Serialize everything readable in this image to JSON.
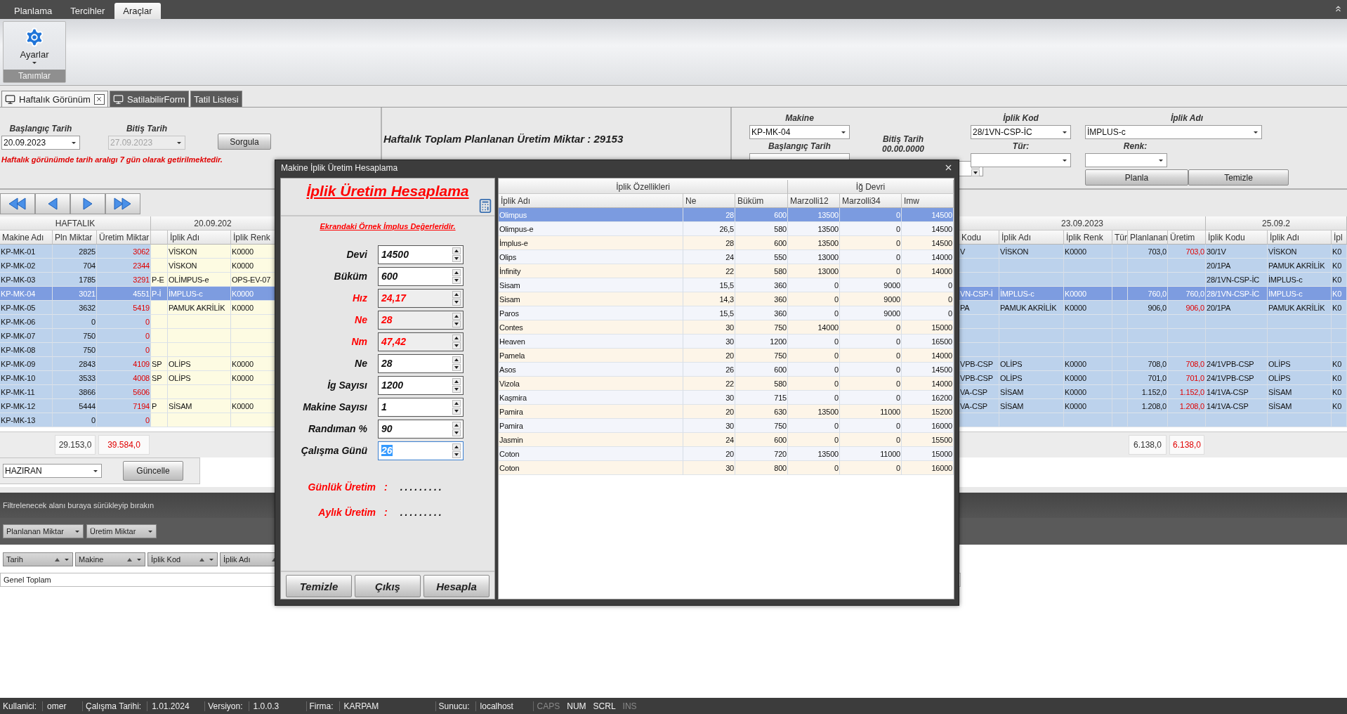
{
  "menu_tabs": [
    {
      "label": "Planlama",
      "selected": false
    },
    {
      "label": "Tercihler",
      "selected": false
    },
    {
      "label": "Araçlar",
      "selected": true
    }
  ],
  "ribbon": {
    "button": "Ayarlar",
    "group": "Tanımlar"
  },
  "doc_tabs": [
    {
      "label": "Haftalık Görünüm",
      "selected": true,
      "closable": true,
      "has_icon": true
    },
    {
      "label": "SatilabilirForm",
      "selected": false,
      "closable": false,
      "has_icon": true
    },
    {
      "label": "Tatil Listesi",
      "selected": false,
      "closable": false,
      "has_icon": false
    }
  ],
  "query": {
    "start_label": "Başlangıç Tarih",
    "start_value": "20.09.2023",
    "end_label": "Bitiş Tarih",
    "end_value": "27.09.2023",
    "end_disabled": true,
    "button": "Sorgula",
    "note": "Haftalık görünümde tarih aralıgı 7 gün olarak getirilmektedir."
  },
  "total_text": "Haftalık Toplam Planlanan Üretim Miktar : 29153",
  "plan_form": {
    "machine_label": "Makine",
    "machine_value": "KP-MK-04",
    "start_label": "Başlangıç Tarih",
    "end_label": "Bitiş Tarih",
    "end_value": "00.00.0000",
    "code_label": "İplik Kod",
    "code_value": "28/1VN-CSP-İC",
    "type_label": "Tür:",
    "name_label": "İplik Adı",
    "name_value": "İMPLUS-c",
    "shade_label": "Renk:",
    "buttons": [
      "Planla",
      "Temizle"
    ]
  },
  "left_grid": {
    "groups": [
      "HAFTALIK",
      "20.09.202"
    ],
    "columns": [
      "Makine Adı",
      "Pln Miktar",
      "Üretim Miktar",
      null,
      "İplik Adı",
      "İplik Renk"
    ],
    "rows": [
      {
        "cells": [
          "KP-MK-01",
          "2825",
          "3062",
          null,
          "VİSKON",
          "K0000"
        ],
        "selected": false
      },
      {
        "cells": [
          "KP-MK-02",
          "704",
          "2344",
          null,
          "VİSKON",
          "K0000"
        ],
        "selected": false
      },
      {
        "cells": [
          "KP-MK-03",
          "1785",
          "3291",
          "P-E",
          "OLİMPUS-e",
          "OPS-EV-07"
        ],
        "selected": false
      },
      {
        "cells": [
          "KP-MK-04",
          "3021",
          "4551",
          "P-İ",
          "İMPLUS-c",
          "K0000"
        ],
        "selected": true
      },
      {
        "cells": [
          "KP-MK-05",
          "3632",
          "5419",
          null,
          "PAMUK AKRİLİK",
          "K0000"
        ],
        "selected": false
      },
      {
        "cells": [
          "KP-MK-06",
          "0",
          "0",
          null,
          null,
          null
        ],
        "selected": false
      },
      {
        "cells": [
          "KP-MK-07",
          "750",
          "0",
          null,
          null,
          null
        ],
        "selected": false
      },
      {
        "cells": [
          "KP-MK-08",
          "750",
          "0",
          null,
          null,
          null
        ],
        "selected": false
      },
      {
        "cells": [
          "KP-MK-09",
          "2843",
          "4109",
          "SP",
          "OLİPS",
          "K0000"
        ],
        "selected": false
      },
      {
        "cells": [
          "KP-MK-10",
          "3533",
          "4008",
          "SP",
          "OLİPS",
          "K0000"
        ],
        "selected": false
      },
      {
        "cells": [
          "KP-MK-11",
          "3866",
          "5606",
          null,
          null,
          null
        ],
        "selected": false
      },
      {
        "cells": [
          "KP-MK-12",
          "5444",
          "7194",
          "P",
          "SİSAM",
          "K0000"
        ],
        "selected": false
      },
      {
        "cells": [
          "KP-MK-13",
          "0",
          "0",
          null,
          null,
          null
        ],
        "selected": false
      }
    ],
    "totals": [
      "29.153,0",
      "39.584,0"
    ]
  },
  "right_grid": {
    "groups": [
      "23.09.2023",
      "25.09.2"
    ],
    "columns": [
      "Kodu",
      "İplik Adı",
      "İplik Renk",
      "Tür",
      "Planlanan",
      "Üretim",
      "İplik Kodu",
      "İplik Adı",
      "İpl"
    ],
    "rows": [
      {
        "cells": [
          "V",
          "VİSKON",
          "K0000",
          null,
          "703,0",
          "703,0",
          "30/1V",
          "VİSKON",
          "K0"
        ],
        "selected": false
      },
      {
        "cells": [
          null,
          null,
          null,
          null,
          null,
          null,
          "20/1PA",
          "PAMUK AKRİLİK",
          "K0"
        ],
        "selected": false
      },
      {
        "cells": [
          null,
          null,
          null,
          null,
          null,
          null,
          "28/1VN-CSP-İC",
          "İMPLUS-c",
          "K0"
        ],
        "selected": false
      },
      {
        "cells": [
          "VN-CSP-İ",
          "İMPLUS-c",
          "K0000",
          null,
          "760,0",
          "760,0",
          "28/1VN-CSP-İC",
          "İMPLUS-c",
          "K0"
        ],
        "selected": true
      },
      {
        "cells": [
          "PA",
          "PAMUK AKRİLİK",
          "K0000",
          null,
          "906,0",
          "906,0",
          "20/1PA",
          "PAMUK AKRİLİK",
          "K0"
        ],
        "selected": false
      },
      {
        "cells": [
          null,
          null,
          null,
          null,
          null,
          null,
          null,
          null,
          null
        ],
        "selected": false
      },
      {
        "cells": [
          null,
          null,
          null,
          null,
          null,
          null,
          null,
          null,
          null
        ],
        "selected": false
      },
      {
        "cells": [
          null,
          null,
          null,
          null,
          null,
          null,
          null,
          null,
          null
        ],
        "selected": false
      },
      {
        "cells": [
          "VPB-CSP",
          "OLİPS",
          "K0000",
          null,
          "708,0",
          "708,0",
          "24/1VPB-CSP",
          "OLİPS",
          "K0"
        ],
        "selected": false
      },
      {
        "cells": [
          "VPB-CSP",
          "OLİPS",
          "K0000",
          null,
          "701,0",
          "701,0",
          "24/1VPB-CSP",
          "OLİPS",
          "K0"
        ],
        "selected": false
      },
      {
        "cells": [
          "VA-CSP",
          "SİSAM",
          "K0000",
          null,
          "1.152,0",
          "1.152,0",
          "14/1VA-CSP",
          "SİSAM",
          "K0"
        ],
        "selected": false
      },
      {
        "cells": [
          "VA-CSP",
          "SİSAM",
          "K0000",
          null,
          "1.208,0",
          "1.208,0",
          "14/1VA-CSP",
          "SİSAM",
          "K0"
        ],
        "selected": false
      },
      {
        "cells": [
          null,
          null,
          null,
          null,
          null,
          null,
          null,
          null,
          null
        ],
        "selected": false
      }
    ],
    "totals": [
      "6.138,0",
      "6.138,0"
    ]
  },
  "period": {
    "month": "HAZIRAN",
    "button": "Güncelle"
  },
  "pivot": {
    "drop_hint": "Filtrelenecek alanı buraya sürükleyip bırakın",
    "data_fields": [
      "Planlanan Miktar",
      "Üretim Miktar"
    ],
    "row_fields": [
      "Tarih",
      "Makine",
      "İplik Kod",
      "İplik Adı"
    ],
    "grand_total": "Genel Toplam"
  },
  "dialog": {
    "title": "Makine İplik Üretim Hesaplama",
    "heading": "İplik Üretim Hesaplama",
    "subheading": "Ekrandaki Örnek İmplus Değerleridir.",
    "fields": [
      {
        "label": "Devi",
        "value": "14500",
        "readonly": false,
        "focused": false
      },
      {
        "label": "Büküm",
        "value": "600",
        "readonly": false,
        "focused": false
      },
      {
        "label": "Hız",
        "value": "24,17",
        "readonly": true,
        "focused": false
      },
      {
        "label": "Ne",
        "value": "28",
        "readonly": true,
        "focused": false
      },
      {
        "label": "Nm",
        "value": "47,42",
        "readonly": true,
        "focused": false
      },
      {
        "label": "Ne",
        "value": "28",
        "readonly": false,
        "focused": false
      },
      {
        "label": "İg Sayısı",
        "value": "1200",
        "readonly": false,
        "focused": false
      },
      {
        "label": "Makine Sayısı",
        "value": "1",
        "readonly": false,
        "focused": false
      },
      {
        "label": "Randıman %",
        "value": "90",
        "readonly": false,
        "focused": false
      },
      {
        "label": "Çalışma Günü",
        "value": "26",
        "readonly": false,
        "focused": true
      }
    ],
    "results": [
      {
        "label": "Günlük Üretim",
        "separator": ":",
        "value": "........."
      },
      {
        "label": "Aylık Üretim",
        "separator": ":",
        "value": "........."
      }
    ],
    "buttons": [
      "Temizle",
      "Çıkış",
      "Hesapla"
    ],
    "table": {
      "groups": [
        "İplik Özellikleri",
        "İğ Devri"
      ],
      "columns": [
        "İplik Adı",
        "Ne",
        "Büküm",
        "Marzolli12",
        "Marzolli34",
        "Imw"
      ],
      "rows": [
        {
          "cells": [
            "Olimpus",
            "28",
            "600",
            "13500",
            "0",
            "14500"
          ],
          "selected": true
        },
        {
          "cells": [
            "Olimpus-e",
            "26,5",
            "580",
            "13500",
            "0",
            "14500"
          ],
          "selected": false
        },
        {
          "cells": [
            "İmplus-e",
            "28",
            "600",
            "13500",
            "0",
            "14500"
          ],
          "selected": false
        },
        {
          "cells": [
            "Olips",
            "24",
            "550",
            "13000",
            "0",
            "14000"
          ],
          "selected": false
        },
        {
          "cells": [
            "İnfinity",
            "22",
            "580",
            "13000",
            "0",
            "14000"
          ],
          "selected": false
        },
        {
          "cells": [
            "Sisam",
            "15,5",
            "360",
            "0",
            "9000",
            "0"
          ],
          "selected": false
        },
        {
          "cells": [
            "Sisam",
            "14,3",
            "360",
            "0",
            "9000",
            "0"
          ],
          "selected": false
        },
        {
          "cells": [
            "Paros",
            "15,5",
            "360",
            "0",
            "9000",
            "0"
          ],
          "selected": false
        },
        {
          "cells": [
            "Contes",
            "30",
            "750",
            "14000",
            "0",
            "15000"
          ],
          "selected": false
        },
        {
          "cells": [
            "Heaven",
            "30",
            "1200",
            "0",
            "0",
            "16500"
          ],
          "selected": false
        },
        {
          "cells": [
            "Pamela",
            "20",
            "750",
            "0",
            "0",
            "14000"
          ],
          "selected": false
        },
        {
          "cells": [
            "Asos",
            "26",
            "600",
            "0",
            "0",
            "14500"
          ],
          "selected": false
        },
        {
          "cells": [
            "Vizola",
            "22",
            "580",
            "0",
            "0",
            "14000"
          ],
          "selected": false
        },
        {
          "cells": [
            "Kaşmira",
            "30",
            "715",
            "0",
            "0",
            "16200"
          ],
          "selected": false
        },
        {
          "cells": [
            "Pamira",
            "20",
            "630",
            "13500",
            "11000",
            "15200"
          ],
          "selected": false
        },
        {
          "cells": [
            "Pamira",
            "30",
            "750",
            "0",
            "0",
            "16000"
          ],
          "selected": false
        },
        {
          "cells": [
            "Jasmin",
            "24",
            "600",
            "0",
            "0",
            "15500"
          ],
          "selected": false
        },
        {
          "cells": [
            "Coton",
            "20",
            "720",
            "13500",
            "11000",
            "15000"
          ],
          "selected": false
        },
        {
          "cells": [
            "Coton",
            "30",
            "800",
            "0",
            "0",
            "16000"
          ],
          "selected": false
        }
      ]
    }
  },
  "status": [
    {
      "label": "Kullanici:",
      "value": "omer"
    },
    {
      "label": "Çalışma Tarihi:",
      "value": "1.01.2024"
    },
    {
      "label": "Versiyon:",
      "value": "1.0.0.3"
    },
    {
      "label": "Firma:",
      "value": "KARPAM"
    },
    {
      "label": "Sunucu:",
      "value": "localhost"
    }
  ],
  "indicators": [
    {
      "label": "CAPS",
      "on": false
    },
    {
      "label": "NUM",
      "on": true
    },
    {
      "label": "SCRL",
      "on": true
    },
    {
      "label": "INS",
      "on": false
    }
  ]
}
